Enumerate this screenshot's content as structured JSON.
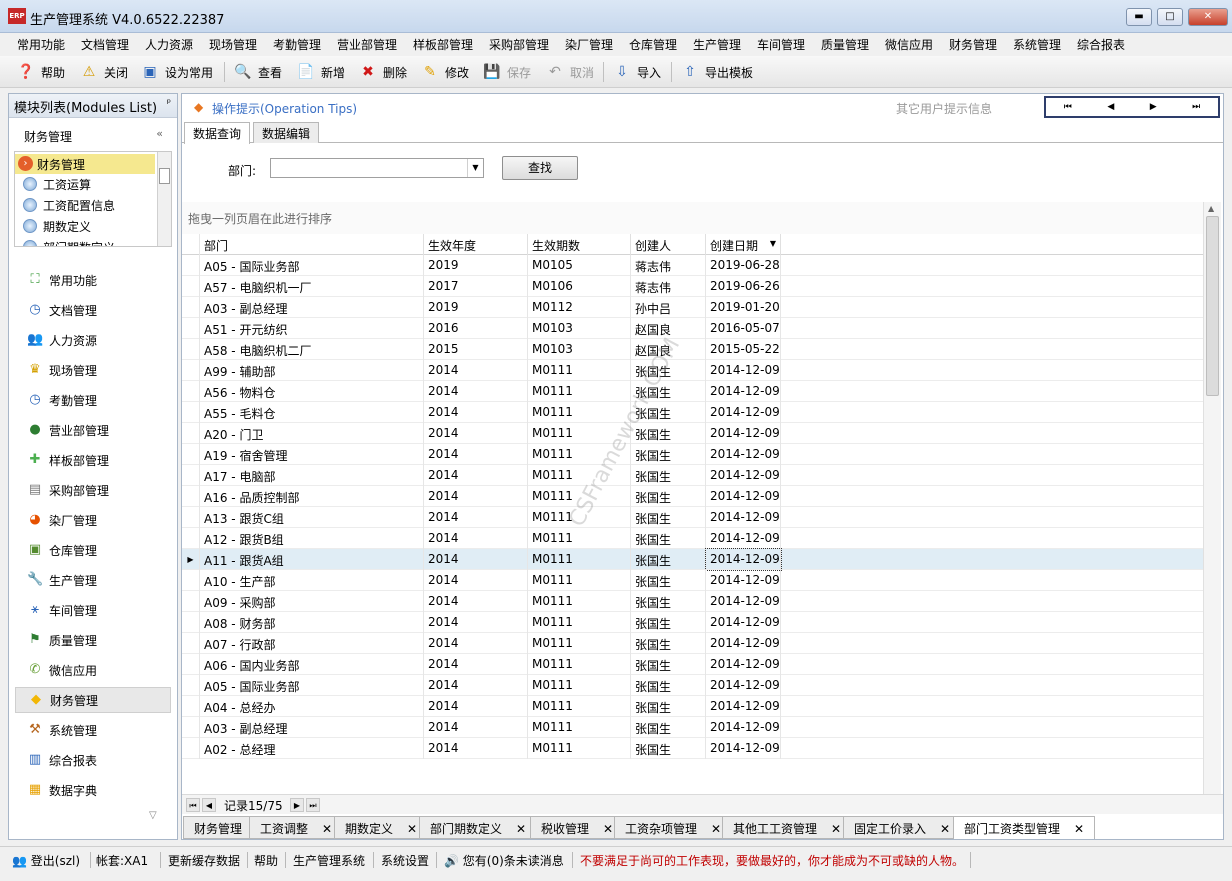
{
  "window": {
    "title": "生产管理系统 V4.0.6522.22387",
    "logo_text": "ERP",
    "min": "▬",
    "max": "□",
    "close": "✕"
  },
  "menu": [
    "常用功能",
    "文档管理",
    "人力资源",
    "现场管理",
    "考勤管理",
    "营业部管理",
    "样板部管理",
    "采购部管理",
    "染厂管理",
    "仓库管理",
    "生产管理",
    "车间管理",
    "质量管理",
    "微信应用",
    "财务管理",
    "系统管理",
    "综合报表"
  ],
  "toolbar": {
    "help": "帮助",
    "close": "关闭",
    "set_common": "设为常用",
    "view": "查看",
    "add": "新增",
    "delete": "删除",
    "edit": "修改",
    "save": "保存",
    "cancel": "取消",
    "import": "导入",
    "export_template": "导出模板"
  },
  "left": {
    "header": "模块列表(Modules List)",
    "pin": "ᵖ",
    "sub": "财务管理",
    "collapse": "«",
    "tree_root": "财务管理",
    "tree_items": [
      "工资运算",
      "工资配置信息",
      "期数定义",
      "部门期数定义"
    ],
    "nav": [
      "常用功能",
      "文档管理",
      "人力资源",
      "现场管理",
      "考勤管理",
      "营业部管理",
      "样板部管理",
      "采购部管理",
      "染厂管理",
      "仓库管理",
      "生产管理",
      "车间管理",
      "质量管理",
      "微信应用",
      "财务管理",
      "系统管理",
      "综合报表",
      "数据字典"
    ],
    "nav_icons": [
      "⛶",
      "◷",
      "👥",
      "♛",
      "◷",
      "●",
      "✚",
      "▤",
      "◕",
      "▣",
      "🔧",
      "⚹",
      "⚑",
      "✆",
      "◆",
      "⚒",
      "▥",
      "▦"
    ],
    "down_arrow": "▽"
  },
  "main": {
    "tips_label": "操作提示(Operation Tips)",
    "tips_icon": "◆",
    "other_tips": "其它用户提示信息",
    "pager": [
      "⏮",
      "◀",
      "▶",
      "⏭"
    ],
    "tabs": [
      "数据查询",
      "数据编辑"
    ],
    "filter_label": "部门:",
    "dept_value": "",
    "find_button": "查找",
    "group_panel": "拖曳一列页眉在此进行排序",
    "columns": [
      "部门",
      "生效年度",
      "生效期数",
      "创建人",
      "创建日期"
    ],
    "rows": [
      [
        "A05 - 国际业务部",
        "2019",
        "M0105",
        "蒋志伟",
        "2019-06-28"
      ],
      [
        "A57 - 电脑织机一厂",
        "2017",
        "M0106",
        "蒋志伟",
        "2019-06-26"
      ],
      [
        "A03 - 副总经理",
        "2019",
        "M0112",
        "孙中吕",
        "2019-01-20"
      ],
      [
        "A51 - 开元纺织",
        "2016",
        "M0103",
        "赵国良",
        "2016-05-07"
      ],
      [
        "A58 - 电脑织机二厂",
        "2015",
        "M0103",
        "赵国良",
        "2015-05-22"
      ],
      [
        "A99 - 辅助部",
        "2014",
        "M0111",
        "张国生",
        "2014-12-09"
      ],
      [
        "A56 - 物料仓",
        "2014",
        "M0111",
        "张国生",
        "2014-12-09"
      ],
      [
        "A55 - 毛料仓",
        "2014",
        "M0111",
        "张国生",
        "2014-12-09"
      ],
      [
        "A20 - 门卫",
        "2014",
        "M0111",
        "张国生",
        "2014-12-09"
      ],
      [
        "A19 - 宿舍管理",
        "2014",
        "M0111",
        "张国生",
        "2014-12-09"
      ],
      [
        "A17 - 电脑部",
        "2014",
        "M0111",
        "张国生",
        "2014-12-09"
      ],
      [
        "A16 - 品质控制部",
        "2014",
        "M0111",
        "张国生",
        "2014-12-09"
      ],
      [
        "A13 - 跟货C组",
        "2014",
        "M0111",
        "张国生",
        "2014-12-09"
      ],
      [
        "A12 - 跟货B组",
        "2014",
        "M0111",
        "张国生",
        "2014-12-09"
      ],
      [
        "A11 - 跟货A组",
        "2014",
        "M0111",
        "张国生",
        "2014-12-09"
      ],
      [
        "A10 - 生产部",
        "2014",
        "M0111",
        "张国生",
        "2014-12-09"
      ],
      [
        "A09 - 采购部",
        "2014",
        "M0111",
        "张国生",
        "2014-12-09"
      ],
      [
        "A08 - 财务部",
        "2014",
        "M0111",
        "张国生",
        "2014-12-09"
      ],
      [
        "A07 - 行政部",
        "2014",
        "M0111",
        "张国生",
        "2014-12-09"
      ],
      [
        "A06 - 国内业务部",
        "2014",
        "M0111",
        "张国生",
        "2014-12-09"
      ],
      [
        "A05 - 国际业务部",
        "2014",
        "M0111",
        "张国生",
        "2014-12-09"
      ],
      [
        "A04 - 总经办",
        "2014",
        "M0111",
        "张国生",
        "2014-12-09"
      ],
      [
        "A03 - 副总经理",
        "2014",
        "M0111",
        "张国生",
        "2014-12-09"
      ],
      [
        "A02 - 总经理",
        "2014",
        "M0111",
        "张国生",
        "2014-12-09"
      ]
    ],
    "selected_row": 14,
    "record_label": "记录15/75",
    "nav_buttons": [
      "⏮",
      "◀",
      "▶",
      "⏭"
    ],
    "watermark": "CSFramework.COM"
  },
  "bottom_tabs": [
    "财务管理",
    "工资调整",
    "期数定义",
    "部门期数定义",
    "税收管理",
    "工资杂项管理",
    "其他工工资管理",
    "固定工价录入",
    "部门工资类型管理"
  ],
  "status": {
    "logout": "登出(szl)",
    "account": "帐套:XA1",
    "refresh_cache": "更新缓存数据",
    "help": "帮助",
    "system": "生产管理系统",
    "settings": "系统设置",
    "messages": "您有(0)条未读消息",
    "motto": "不要满足于尚可的工作表现，要做最好的，你才能成为不可或缺的人物。"
  },
  "colors": {
    "accent": "#3a6fc4",
    "selected_row": "#e0edf5",
    "motto": "#c00000",
    "tree_highlight": "#f5e88f"
  }
}
